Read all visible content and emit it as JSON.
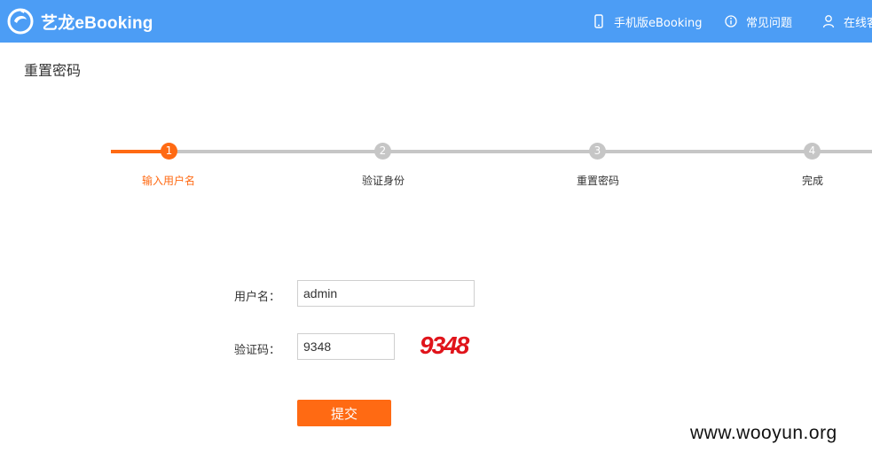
{
  "header": {
    "logo_text": "艺龙eBooking",
    "nav": {
      "mobile": "手机版eBooking",
      "faq": "常见问题",
      "service": "在线客服"
    }
  },
  "page": {
    "title": "重置密码"
  },
  "steps": [
    {
      "number": "1",
      "label": "输入用户名"
    },
    {
      "number": "2",
      "label": "验证身份"
    },
    {
      "number": "3",
      "label": "重置密码"
    },
    {
      "number": "4",
      "label": "完成"
    }
  ],
  "form": {
    "username_label": "用户名：",
    "username_value": "admin",
    "captcha_label": "验证码：",
    "captcha_value": "9348",
    "captcha_image_text": "9348",
    "submit_label": "提交"
  },
  "watermark": "www.wooyun.org",
  "colors": {
    "header_bg": "#4c9df5",
    "accent": "#ff6a13",
    "step_inactive": "#c6c6c6",
    "captcha": "#e0141b"
  }
}
